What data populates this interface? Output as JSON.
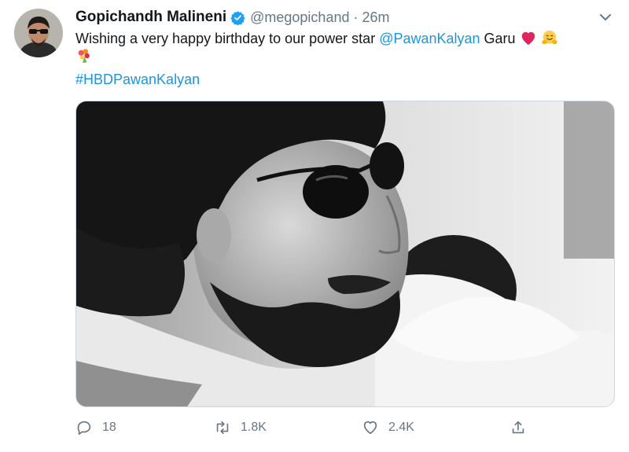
{
  "author": {
    "name": "Gopichandh Malineni",
    "handle": "@megopichand",
    "time": "26m"
  },
  "tweet": {
    "text_prefix": "Wishing a very happy birthday to our power star ",
    "mention": "@PawanKalyan",
    "text_suffix": " Garu ",
    "hashtag": "#HBDPawanKalyan"
  },
  "actions": {
    "replies": "18",
    "retweets": "1.8K",
    "likes": "2.4K"
  },
  "colors": {
    "link": "#1b95e0",
    "secondary_text": "#657786",
    "verified": "#1da1f2",
    "heart": "#e0245e"
  },
  "icons": {
    "verified": "verified-badge-icon",
    "caret": "chevron-down-icon",
    "reply": "reply-icon",
    "retweet": "retweet-icon",
    "like": "heart-outline-icon",
    "share": "share-icon"
  }
}
